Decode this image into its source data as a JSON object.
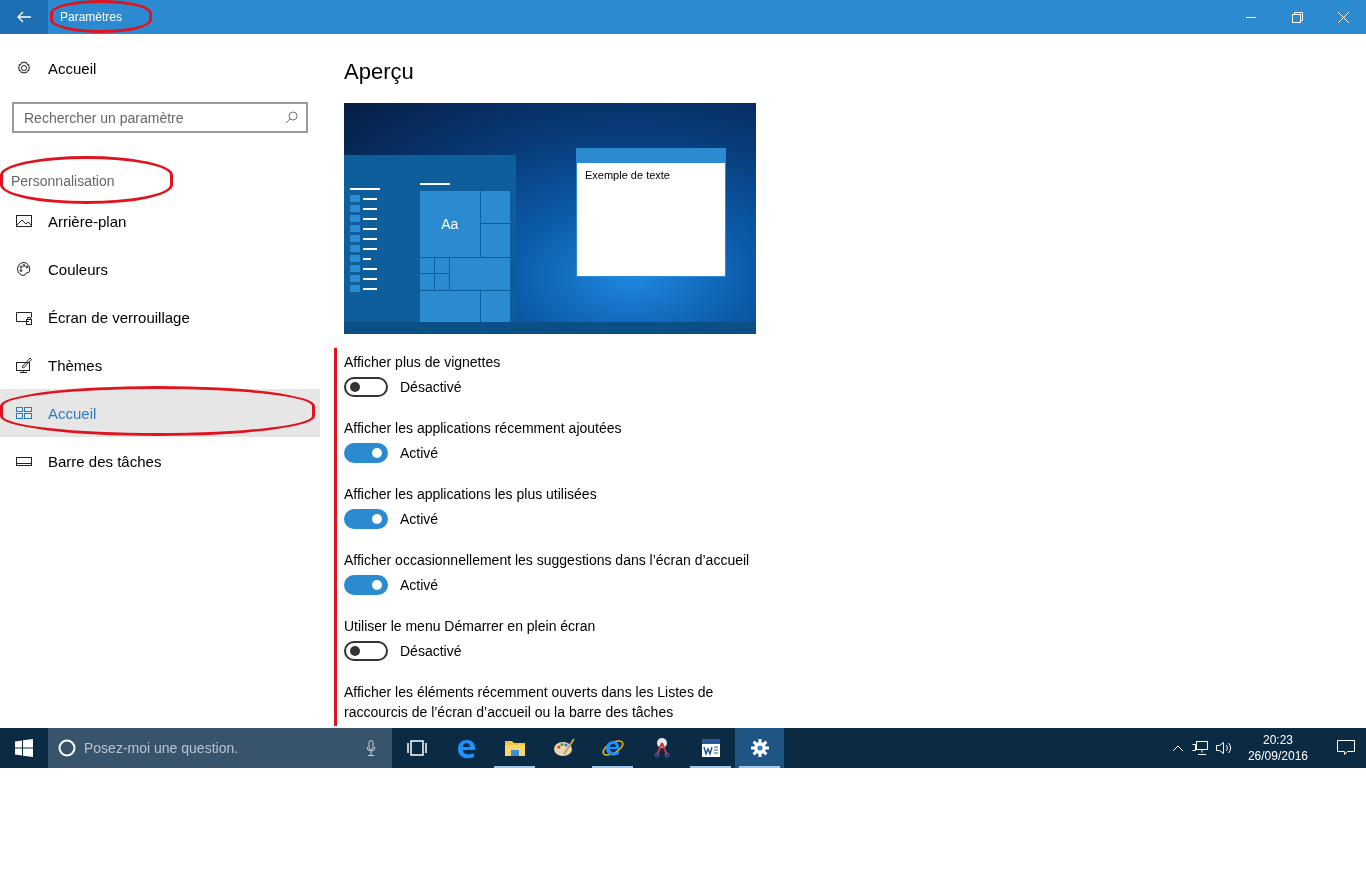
{
  "window": {
    "title": "Paramètres"
  },
  "sidebar": {
    "home": "Accueil",
    "search": {
      "placeholder": "Rechercher un paramètre"
    },
    "section": "Personnalisation",
    "items": [
      {
        "label": "Arrière-plan",
        "kind": "picture",
        "selected": false
      },
      {
        "label": "Couleurs",
        "kind": "palette",
        "selected": false
      },
      {
        "label": "Écran de verrouillage",
        "kind": "lock",
        "selected": false
      },
      {
        "label": "Thèmes",
        "kind": "themes",
        "selected": false
      },
      {
        "label": "Accueil",
        "kind": "start",
        "selected": true
      },
      {
        "label": "Barre des tâches",
        "kind": "taskbar",
        "selected": false
      }
    ]
  },
  "content": {
    "heading": "Aperçu",
    "preview": {
      "tile_text": "Aa",
      "window_text": "Exemple de texte"
    },
    "settings": [
      {
        "label": "Afficher plus de vignettes",
        "on": false,
        "state": "Désactivé"
      },
      {
        "label": "Afficher les applications récemment ajoutées",
        "on": true,
        "state": "Activé"
      },
      {
        "label": "Afficher les applications les plus utilisées",
        "on": true,
        "state": "Activé"
      },
      {
        "label": "Afficher occasionnellement les suggestions dans l’écran d’accueil",
        "on": true,
        "state": "Activé"
      },
      {
        "label": "Utiliser le menu Démarrer en plein écran",
        "on": false,
        "state": "Désactivé"
      },
      {
        "label": "Afficher les éléments récemment ouverts dans les Listes de raccourcis de l’écran d’accueil ou la barre des tâches",
        "kind": "text"
      }
    ]
  },
  "taskbar": {
    "search": {
      "placeholder": "Posez-moi une question."
    },
    "apps": [
      {
        "kind": "taskview",
        "running": false,
        "selected": false
      },
      {
        "kind": "edge",
        "running": false,
        "selected": false
      },
      {
        "kind": "folder",
        "running": true,
        "selected": false
      },
      {
        "kind": "paint",
        "running": false,
        "selected": false
      },
      {
        "kind": "ie",
        "running": true,
        "selected": false
      },
      {
        "kind": "scissors",
        "running": false,
        "selected": false
      },
      {
        "kind": "word",
        "running": true,
        "selected": false
      },
      {
        "kind": "gear",
        "running": true,
        "selected": true
      }
    ],
    "time": "20:23",
    "date": "26/09/2016"
  }
}
